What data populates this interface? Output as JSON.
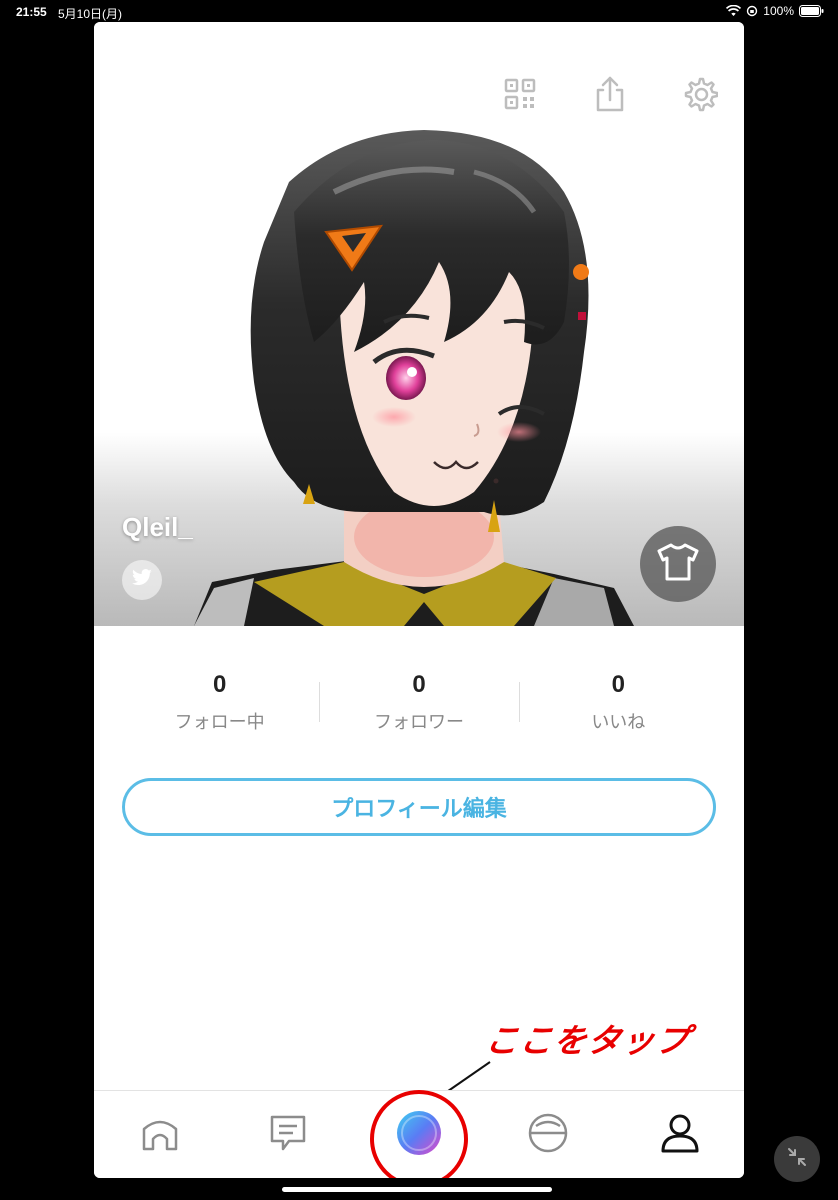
{
  "status_bar": {
    "time": "21:55",
    "date": "5月10日(月)",
    "battery": "100%"
  },
  "header_icons": [
    "qr-code-icon",
    "share-icon",
    "settings-gear-icon"
  ],
  "profile": {
    "username": "Qleil_"
  },
  "stats": [
    {
      "count": "0",
      "label": "フォロー中"
    },
    {
      "count": "0",
      "label": "フォロワー"
    },
    {
      "count": "0",
      "label": "いいね"
    }
  ],
  "edit_button_label": "プロフィール編集",
  "annotation": {
    "text": "ここをタップ",
    "color": "#e80000"
  },
  "tabbar": {
    "items": [
      "home-icon",
      "chat-icon",
      "create-icon",
      "explore-ball-icon",
      "profile-icon"
    ],
    "active": "profile-icon"
  },
  "colors": {
    "accent": "#4ab4e2",
    "annotation": "#e80000"
  }
}
